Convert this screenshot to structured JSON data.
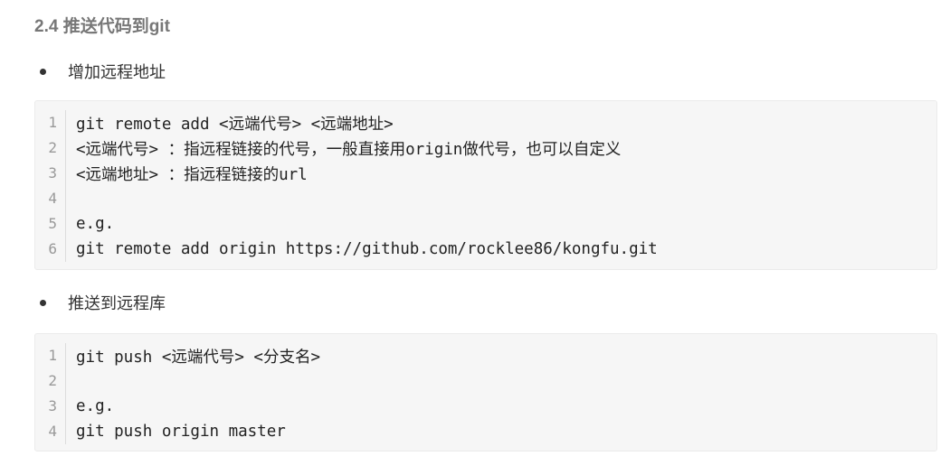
{
  "heading": "2.4 推送代码到git",
  "sections": [
    {
      "bullet": "增加远程地址",
      "code": [
        {
          "n": "1",
          "text": "git remote add <远端代号> <远端地址>"
        },
        {
          "n": "2",
          "text": "<远端代号> ：指远程链接的代号，一般直接用origin做代号，也可以自定义"
        },
        {
          "n": "3",
          "text": "<远端地址> ：指远程链接的url"
        },
        {
          "n": "4",
          "text": ""
        },
        {
          "n": "5",
          "text": "e.g."
        },
        {
          "n": "6",
          "text": "git remote add origin https://github.com/rocklee86/kongfu.git"
        }
      ]
    },
    {
      "bullet": "推送到远程库",
      "code": [
        {
          "n": "1",
          "text": "git push <远端代号> <分支名>"
        },
        {
          "n": "2",
          "text": ""
        },
        {
          "n": "3",
          "text": "e.g."
        },
        {
          "n": "4",
          "text": "git push origin master"
        }
      ]
    }
  ]
}
